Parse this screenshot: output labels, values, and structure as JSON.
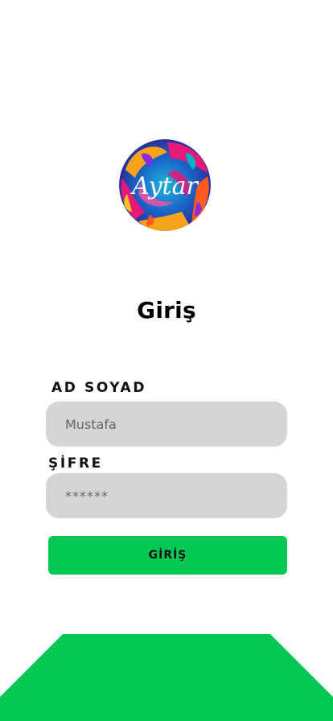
{
  "logo": {
    "text": "Aytar",
    "colors": [
      "#1a7fd0",
      "#e6197a",
      "#f7a21b",
      "#8a2be2",
      "#ff5a1f",
      "#00b3c7"
    ]
  },
  "page": {
    "title": "Giriş"
  },
  "form": {
    "name_label": "AD SOYAD",
    "name_value": "Mustafa",
    "password_label": "ŞİFRE",
    "password_value": "******",
    "submit_label": "GİRİŞ"
  },
  "theme": {
    "accent": "#05c854",
    "input_bg": "#d5d5d5"
  }
}
